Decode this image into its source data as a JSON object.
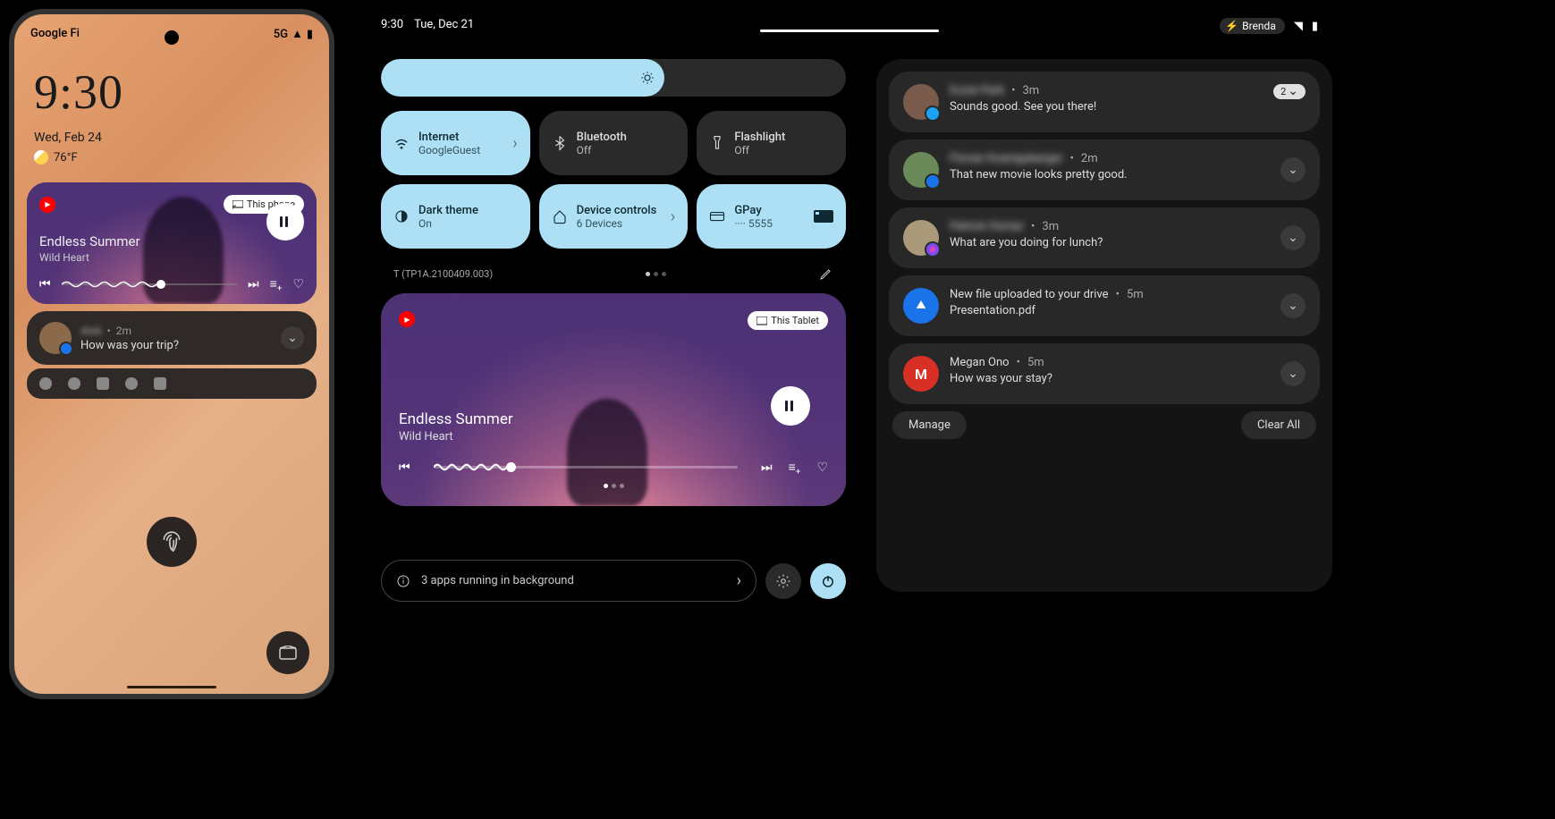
{
  "phone": {
    "carrier": "Google Fi",
    "network": "5G",
    "time": "9:30",
    "date": "Wed, Feb 24",
    "temp": "76°F",
    "media": {
      "cast": "This phone",
      "title": "Endless Summer",
      "artist": "Wild Heart"
    },
    "notif": {
      "sender": "Alok",
      "time": "2m",
      "message": "How was your trip?"
    }
  },
  "tablet": {
    "status_time": "9:30",
    "status_date": "Tue, Dec 21",
    "user": "Brenda",
    "tiles": [
      {
        "title": "Internet",
        "sub": "GoogleGuest",
        "on": true,
        "chev": true
      },
      {
        "title": "Bluetooth",
        "sub": "Off",
        "on": false
      },
      {
        "title": "Flashlight",
        "sub": "Off",
        "on": false
      },
      {
        "title": "Dark theme",
        "sub": "On",
        "on": true
      },
      {
        "title": "Device controls",
        "sub": "6 Devices",
        "on": true,
        "chev": true
      },
      {
        "title": "GPay",
        "sub": "···· 5555",
        "on": true,
        "card": true
      }
    ],
    "build": "T (TP1A.2100409.003)",
    "media": {
      "cast": "This Tablet",
      "title": "Endless Summer",
      "artist": "Wild Heart"
    },
    "bg_apps": "3 apps running in background"
  },
  "notif_panel": {
    "items": [
      {
        "sender": "Eunie Park",
        "time": "3m",
        "msg": "Sounds good. See you there!",
        "count": "2",
        "badge": "twitter",
        "blur": true
      },
      {
        "sender": "Florian Koenigsberger",
        "time": "2m",
        "msg": "That new movie looks pretty good.",
        "badge": "msg",
        "blur": true
      },
      {
        "sender": "Patrick Homer",
        "time": "3m",
        "msg": "What are you doing for lunch?",
        "badge": "messenger",
        "blur": true
      },
      {
        "sender": "New file uploaded to your drive",
        "time": "5m",
        "msg": "Presentation.pdf",
        "app": "drive"
      },
      {
        "sender": "Megan Ono",
        "time": "5m",
        "msg": "How was your stay?",
        "app": "gmail"
      }
    ],
    "manage": "Manage",
    "clear": "Clear All"
  }
}
